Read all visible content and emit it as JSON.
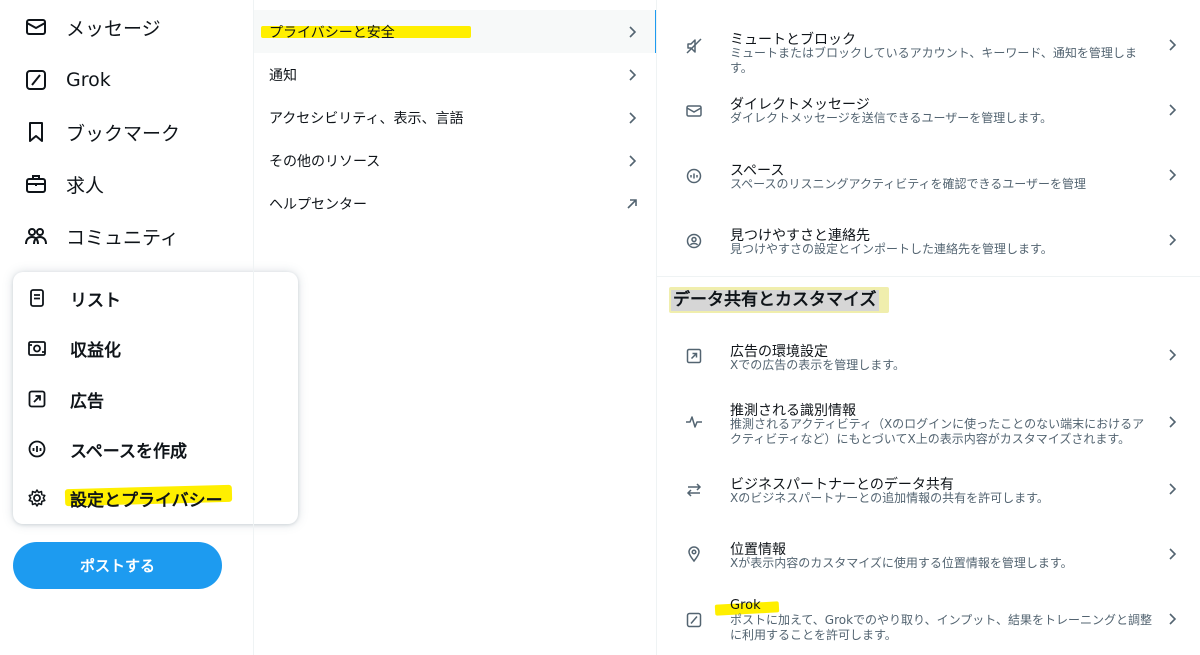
{
  "nav": {
    "items": [
      {
        "label": "メッセージ",
        "icon": "envelope-icon"
      },
      {
        "label": "Grok",
        "icon": "grok-icon"
      },
      {
        "label": "ブックマーク",
        "icon": "bookmark-icon"
      },
      {
        "label": "求人",
        "icon": "briefcase-icon"
      },
      {
        "label": "コミュニティ",
        "icon": "people-icon"
      }
    ],
    "popup": [
      {
        "label": "リスト",
        "icon": "list-icon"
      },
      {
        "label": "収益化",
        "icon": "monetization-icon"
      },
      {
        "label": "広告",
        "icon": "ads-arrow-icon"
      },
      {
        "label": "スペースを作成",
        "icon": "spaces-icon"
      },
      {
        "label": "設定とプライバシー",
        "icon": "gear-icon"
      }
    ],
    "post_button": "ポストする"
  },
  "settings_menu": [
    {
      "label": "プライバシーと安全",
      "icon": "chevron-right-icon"
    },
    {
      "label": "通知",
      "icon": "chevron-right-icon"
    },
    {
      "label": "アクセシビリティ、表示、言語",
      "icon": "chevron-right-icon"
    },
    {
      "label": "その他のリソース",
      "icon": "chevron-right-icon"
    },
    {
      "label": "ヘルプセンター",
      "icon": "external-link-icon"
    }
  ],
  "privacy": {
    "items": [
      {
        "title": "ミュートとブロック",
        "desc": "ミュートまたはブロックしているアカウント、キーワード、通知を管理します。",
        "icon": "mute-icon"
      },
      {
        "title": "ダイレクトメッセージ",
        "desc": "ダイレクトメッセージを送信できるユーザーを管理します。",
        "icon": "envelope-icon"
      },
      {
        "title": "スペース",
        "desc": "スペースのリスニングアクティビティを確認できるユーザーを管理",
        "icon": "spaces-icon"
      },
      {
        "title": "見つけやすさと連絡先",
        "desc": "見つけやすさの設定とインポートした連絡先を管理します。",
        "icon": "discoverability-icon"
      }
    ],
    "section_title": "データ共有とカスタマイズ",
    "section_items": [
      {
        "title": "広告の環境設定",
        "desc": "Xでの広告の表示を管理します。",
        "icon": "ads-arrow-icon"
      },
      {
        "title": "推測される識別情報",
        "desc": "推測されるアクティビティ（Xのログインに使ったことのない端末におけるアクティビティなど）にもとづいてX上の表示内容がカスタマイズされます。",
        "icon": "activity-icon"
      },
      {
        "title": "ビジネスパートナーとのデータ共有",
        "desc": "Xのビジネスパートナーとの追加情報の共有を許可します。",
        "icon": "exchange-icon"
      },
      {
        "title": "位置情報",
        "desc": "Xが表示内容のカスタマイズに使用する位置情報を管理します。",
        "icon": "location-pin-icon"
      },
      {
        "title": "Grok",
        "desc": "ポストに加えて、Grokでのやり取り、インプット、結果をトレーニングと調整に利用することを許可します。",
        "icon": "grok-icon"
      }
    ]
  },
  "colors": {
    "accent": "#1d9bf0",
    "highlight": "#ffef00",
    "text": "#0f1419",
    "secondary": "#536471"
  }
}
